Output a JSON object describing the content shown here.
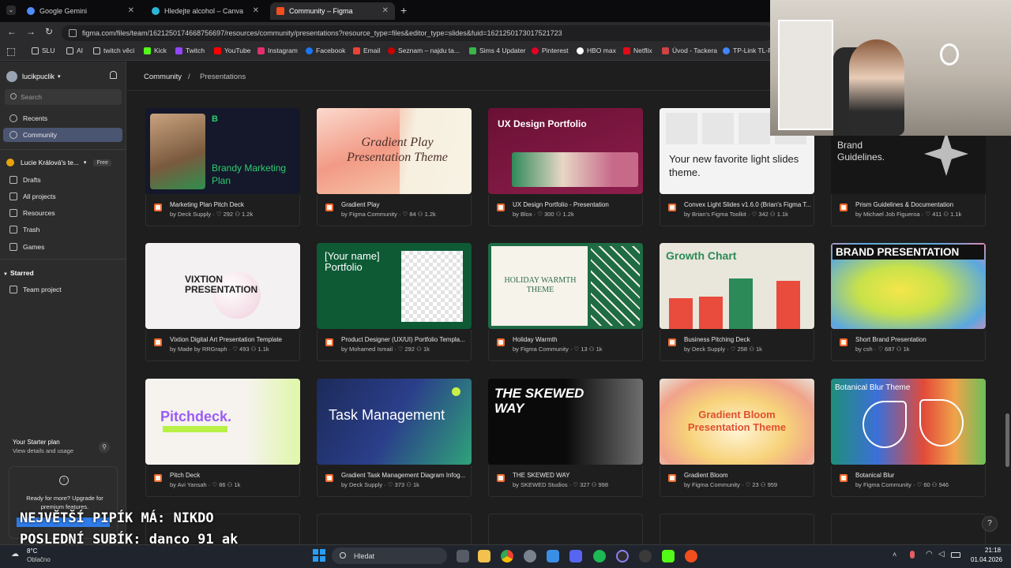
{
  "browser": {
    "tabs": [
      {
        "label": "Google Gemini",
        "color": "#4f8df7"
      },
      {
        "label": "Hledejte alcohol – Canva",
        "color": "#2bb5d8"
      },
      {
        "label": "Community – Figma",
        "color": "#f24e1e"
      }
    ],
    "new_tab": "+",
    "url": "figma.com/files/team/1621250174668756697/resources/community/presentations?resource_type=files&editor_type=slides&fuid=1621250173017521723",
    "bookmarks": [
      "SLU",
      "AI",
      "twitch věci",
      "Kick",
      "Twitch",
      "YouTube",
      "Instagram",
      "Facebook",
      "Email",
      "Seznam – najdu ta...",
      "Sims 4 Updater",
      "Pinterest",
      "HBO max",
      "Netflix",
      "Úvod - Tackera",
      "TP-Link TL-P"
    ]
  },
  "sidebar": {
    "user": "lucikpuclik",
    "search_placeholder": "Search",
    "nav": [
      "Recents",
      "Community"
    ],
    "team": {
      "name": "Lucie Králová's te...",
      "badge": "Free"
    },
    "team_items": [
      "Drafts",
      "All projects",
      "Resources",
      "Trash",
      "Games"
    ],
    "starred_heading": "Starred",
    "starred_items": [
      "Team project"
    ],
    "plan": {
      "title": "Your Starter plan",
      "subtitle": "View details and usage"
    },
    "upgrade": "Ready for more? Upgrade for premium features."
  },
  "breadcrumb": {
    "root": "Community",
    "sep": "/",
    "current": "Presentations"
  },
  "cards": [
    {
      "title": "Marketing Plan Pitch Deck",
      "author": "by Deck Supply",
      "likes": "292",
      "uses": "1.2k",
      "thumb_text": "Brandy Marketing Plan"
    },
    {
      "title": "Gradient Play",
      "author": "by Figma Community",
      "likes": "84",
      "uses": "1.2k",
      "thumb_text": "Gradient Play Presentation Theme"
    },
    {
      "title": "UX Design Portfolio - Presentation",
      "author": "by Blox",
      "likes": "300",
      "uses": "1.2k",
      "thumb_text": "UX Design Portfolio"
    },
    {
      "title": "Convex Light Slides v1.6.0 (Brian's Figma T...",
      "author": "by Brian's Figma Toolkit",
      "likes": "342",
      "uses": "1.1k",
      "thumb_text": "Your new favorite light slides theme."
    },
    {
      "title": "Prism Guidelines & Documentation",
      "author": "by Michael Job Figueroa",
      "likes": "411",
      "uses": "1.1k",
      "thumb_text": "Brand Guidelines."
    },
    {
      "title": "Vixtion Digital Art Presentation Template",
      "author": "by Made by RRGraph",
      "likes": "493",
      "uses": "1.1k",
      "thumb_text": "VIXTION PRESENTATION"
    },
    {
      "title": "Product Designer (UX/UI) Portfolio Templa...",
      "author": "by Mohamed Ismail",
      "likes": "292",
      "uses": "1k",
      "thumb_text": "[Your name] Portfolio"
    },
    {
      "title": "Holiday Warmth",
      "author": "by Figma Community",
      "likes": "13",
      "uses": "1k",
      "thumb_text": "HOLIDAY WARMTH THEME"
    },
    {
      "title": "Business Pitching Deck",
      "author": "by Deck Supply",
      "likes": "258",
      "uses": "1k",
      "thumb_text": "Growth Chart"
    },
    {
      "title": "Short Brand Presentation",
      "author": "by csh",
      "likes": "687",
      "uses": "1k",
      "thumb_text": "BRAND PRESENTATION"
    },
    {
      "title": "Pitch Deck",
      "author": "by Avi Yansah",
      "likes": "86",
      "uses": "1k",
      "thumb_text": "Pitchdeck."
    },
    {
      "title": "Gradient Task Management Diagram Infog...",
      "author": "by Deck Supply",
      "likes": "373",
      "uses": "1k",
      "thumb_text": "Task Management"
    },
    {
      "title": "THE SKEWED WAY",
      "author": "by SKEWED Studios",
      "likes": "327",
      "uses": "998",
      "thumb_text": "THE SKEWED WAY"
    },
    {
      "title": "Gradient Bloom",
      "author": "by Figma Community",
      "likes": "23",
      "uses": "959",
      "thumb_text": "Gradient Bloom Presentation Theme"
    },
    {
      "title": "Botanical Blur",
      "author": "by Figma Community",
      "likes": "60",
      "uses": "946",
      "thumb_text": "Botanical Blur Theme"
    }
  ],
  "overlay": {
    "line1": "NEJVĚTŠÍ PIPÍK MÁ: NIKDO",
    "line2": "POSLEDNÍ SUBÍK: danco_91_ak"
  },
  "taskbar": {
    "weather_temp": "8°C",
    "weather_desc": "Oblačno",
    "search": "Hledat",
    "time": "21:18",
    "date": "01.04.2026"
  },
  "help": "?"
}
